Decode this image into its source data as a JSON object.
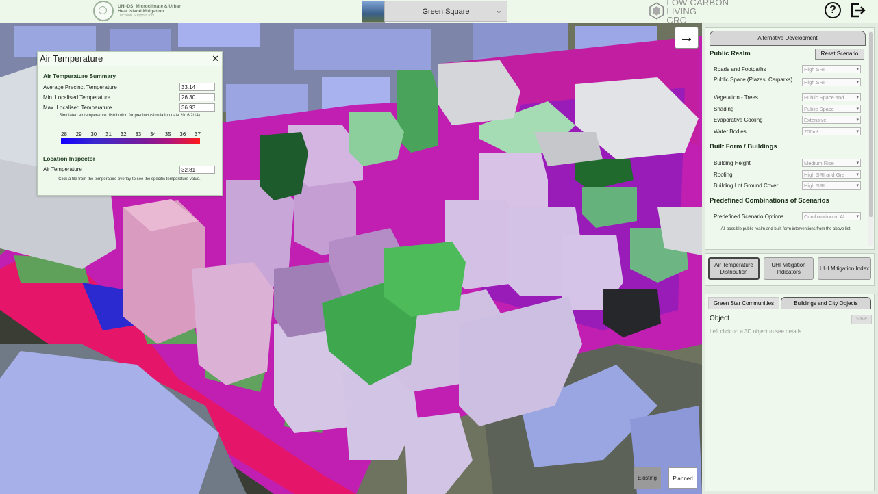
{
  "header": {
    "logo_left": {
      "line1": "UHI-DS: Microclimate & Urban",
      "line2": "Heat Island Mitigation",
      "line3": "Decision Support Tool"
    },
    "precinct_select": "Green Square",
    "crc_logo": {
      "line1": "LOW CARBON LIVING",
      "line2": "CRC"
    },
    "help_label": "?",
    "logout_icon": "logout-icon"
  },
  "air_panel": {
    "title": "Air Temperature",
    "close": "✕",
    "summary_title": "Air Temperature Summary",
    "rows": [
      {
        "label": "Average Precinct Temperature",
        "value": "33.14"
      },
      {
        "label": "Min. Localised Temperature",
        "value": "26.30"
      },
      {
        "label": "Max. Localised Temperature",
        "value": "36.93"
      }
    ],
    "sim_note": "Simulated air temperature distribution for precinct (simulation date 2016/2/14).",
    "legend_ticks": [
      "28",
      "29",
      "30",
      "31",
      "32",
      "33",
      "34",
      "35",
      "36",
      "37"
    ],
    "inspector_title": "Location Inspector",
    "inspector_label": "Air Temperature",
    "inspector_value": "32.81",
    "inspector_note": "Click a tile from the temperature overlay to see the specific temperature value."
  },
  "map": {
    "arrow": "→",
    "toggle_existing": "Existing",
    "toggle_planned": "Planned"
  },
  "right_panel": {
    "tab_title": "Alternative Development",
    "public_realm_title": "Public Realm",
    "reset_label": "Reset Scenario",
    "public_realm": [
      {
        "label": "Roads and Footpaths",
        "value": "High SRI"
      },
      {
        "label": "Public Space (Plazas, Carparks)",
        "value": "High SRI"
      },
      {
        "label": "Vegetation - Trees",
        "value": "Public Space and"
      },
      {
        "label": "Shading",
        "value": "Public Space"
      },
      {
        "label": "Evaporative Cooling",
        "value": "Extensive"
      },
      {
        "label": "Water Bodies",
        "value": "200m²"
      }
    ],
    "built_form_title": "Built Form / Buildings",
    "built_form": [
      {
        "label": "Building Height",
        "value": "Medium Rise"
      },
      {
        "label": "Roofing",
        "value": "High SRI and Gre"
      },
      {
        "label": "Building Lot Ground Cover",
        "value": "High SRI"
      }
    ],
    "predef_title": "Predefined Combinations of Scenarios",
    "predef_label": "Predefined Scenario Options",
    "predef_value": "Combination of Al",
    "predef_note": "All possible public realm and built form interventions from the above list",
    "buttons": [
      {
        "label": "Air Temperature Distribution"
      },
      {
        "label": "UHI Mitigation Indicators"
      },
      {
        "label": "UHI Mitigation Index"
      }
    ],
    "tabs": [
      "Green Star Communities",
      "Buildings and City Objects"
    ],
    "object_label": "Object",
    "save_label": "Save",
    "object_hint": "Left click on a 3D object to see details."
  }
}
